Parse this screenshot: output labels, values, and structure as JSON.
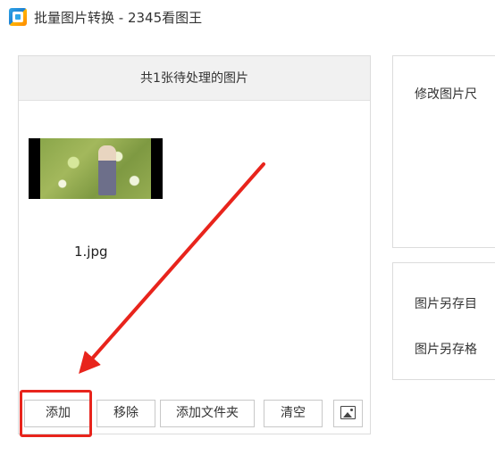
{
  "window": {
    "title": "批量图片转换 - 2345看图王"
  },
  "left_panel": {
    "header": "共1张待处理的图片",
    "files": [
      {
        "name": "1.jpg"
      }
    ],
    "buttons": {
      "add": "添加",
      "remove": "移除",
      "add_folder": "添加文件夹",
      "clear": "清空",
      "image_icon": "image-icon"
    }
  },
  "right_panel": {
    "resize_label": "修改图片尺",
    "save_dir_label": "图片另存目",
    "save_format_label": "图片另存格"
  },
  "annotation": {
    "highlight_color": "#e8241c"
  }
}
